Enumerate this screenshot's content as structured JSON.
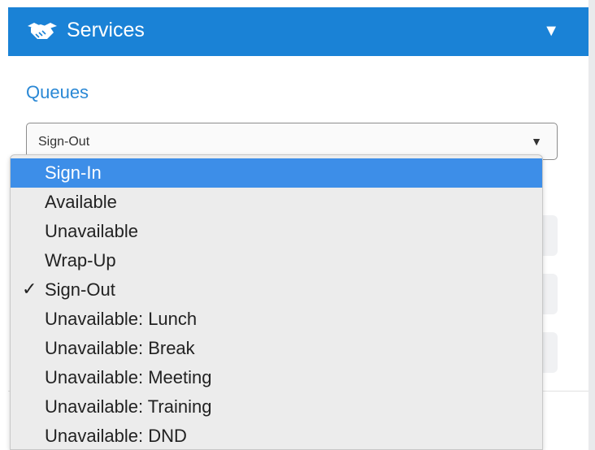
{
  "panel": {
    "title": "Services"
  },
  "queues": {
    "label": "Queues",
    "selected_value": "Sign-Out"
  },
  "dropdown": {
    "highlighted": "Sign-In",
    "checked": "Sign-Out",
    "options": [
      "Sign-In",
      "Available",
      "Unavailable",
      "Wrap-Up",
      "Sign-Out",
      "Unavailable: Lunch",
      "Unavailable: Break",
      "Unavailable: Meeting",
      "Unavailable: Training",
      "Unavailable: DND"
    ]
  },
  "icons": {
    "header": "handshake-icon",
    "collapse": "caret-down-icon",
    "select_arrow": "dropdown-arrow-icon",
    "check": "checkmark-icon"
  },
  "colors": {
    "header_bg": "#1a82d6",
    "label": "#2a88d5",
    "highlight": "#3d8ee8"
  }
}
